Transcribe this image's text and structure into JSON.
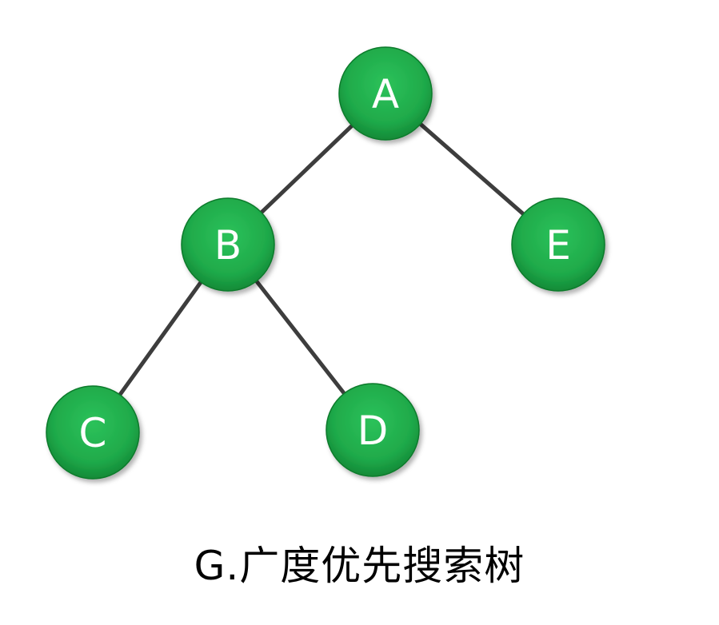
{
  "caption": "G.广度优先搜索树",
  "colors": {
    "node_fill": "#1faa4a",
    "node_stroke": "#0a7a2c",
    "edge": "#3d3d3d",
    "label": "#ffffff"
  },
  "nodes": [
    {
      "id": "A",
      "label": "A"
    },
    {
      "id": "B",
      "label": "B"
    },
    {
      "id": "E",
      "label": "E"
    },
    {
      "id": "C",
      "label": "C"
    },
    {
      "id": "D",
      "label": "D"
    }
  ],
  "edges": [
    {
      "from": "A",
      "to": "B"
    },
    {
      "from": "A",
      "to": "E"
    },
    {
      "from": "B",
      "to": "C"
    },
    {
      "from": "B",
      "to": "D"
    }
  ]
}
